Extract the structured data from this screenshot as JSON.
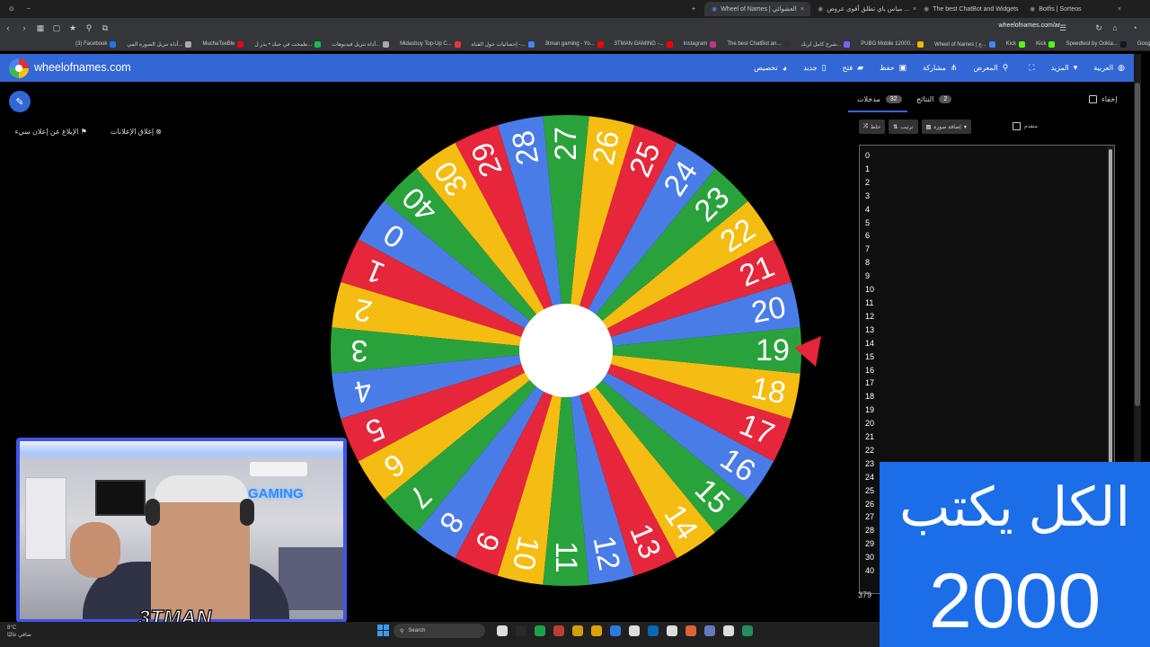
{
  "browser": {
    "tabs": [
      {
        "label": "Wheel of Names | العشوائي",
        "active": true
      },
      {
        "label": "مياس باي تطلق أقوى عروض ...",
        "active": false
      },
      {
        "label": "The best ChatBot and Widgets",
        "active": false
      },
      {
        "label": "Botfis | Sorteos",
        "active": false
      }
    ],
    "new_tab_label": "+",
    "url": "wheelofnames.com/ar",
    "bookmarks": [
      {
        "label": "(3) Facebook",
        "color": "#1877f2"
      },
      {
        "label": "أداة تنزيل الصورة المي...",
        "color": "#aaaaaa"
      },
      {
        "label": "MuchaTseBle",
        "color": "#e60023"
      },
      {
        "label": "طمحت في حبك • يذر ل...",
        "color": "#1db954"
      },
      {
        "label": "أداة تنزيل فيديوهات...",
        "color": "#aaaaaa"
      },
      {
        "label": "Midasbuy Top-Up C...",
        "color": "#e53935"
      },
      {
        "label": "إحصائيات حول القناة -...",
        "color": "#4285f4"
      },
      {
        "label": "3tman gaming - Yo...",
        "color": "#ff0000"
      },
      {
        "label": "3TMAN GAMING -...",
        "color": "#ff0000"
      },
      {
        "label": "Instagram",
        "color": "#c13584"
      },
      {
        "label": "The best ChatBot an...",
        "color": "#333333"
      },
      {
        "label": "شرح كامل لربك...",
        "color": "#7b61ff"
      },
      {
        "label": "PUBG Mobile 12000...",
        "color": "#f4b400"
      },
      {
        "label": "Wheel of Names | ع...",
        "color": "#4285f4"
      },
      {
        "label": "Kick",
        "color": "#53fc18"
      },
      {
        "label": "Kick",
        "color": "#53fc18"
      },
      {
        "label": "Speedtest by Ookla...",
        "color": "#141526"
      },
      {
        "label": "Google",
        "color": "#4285f4"
      }
    ]
  },
  "app": {
    "brand": "wheelofnames.com",
    "menu": [
      {
        "label": "العربية",
        "icon": "globe-icon",
        "glyph": "◍"
      },
      {
        "label": "المزيد",
        "icon": "caret-down-icon",
        "glyph": "▾"
      },
      {
        "label": "",
        "icon": "fullscreen-icon",
        "glyph": "⛶"
      },
      {
        "label": "المعرض",
        "icon": "search-icon",
        "glyph": "⚲"
      },
      {
        "label": "مشاركة",
        "icon": "share-icon",
        "glyph": "⋔"
      },
      {
        "label": "حفظ",
        "icon": "save-icon",
        "glyph": "▣"
      },
      {
        "label": "فتح",
        "icon": "folder-icon",
        "glyph": "▰"
      },
      {
        "label": "جديد",
        "icon": "new-file-icon",
        "glyph": "▯"
      },
      {
        "label": "تخصيص",
        "icon": "palette-icon",
        "glyph": "◕"
      }
    ],
    "ads": {
      "close": "إغلاق الإعلانات",
      "report": "الإبلاغ عن إعلان سيء"
    }
  },
  "wheel": {
    "labels": [
      "0",
      "1",
      "2",
      "3",
      "4",
      "5",
      "6",
      "7",
      "8",
      "9",
      "10",
      "11",
      "12",
      "13",
      "14",
      "15",
      "16",
      "17",
      "18",
      "19",
      "20",
      "21",
      "22",
      "23",
      "24",
      "25",
      "26",
      "27",
      "28",
      "29",
      "30",
      "40"
    ],
    "palette": [
      "#4a7ce8",
      "#e5263b",
      "#f5bd12",
      "#2aa23c"
    ],
    "text_color": "#ffffff"
  },
  "panel": {
    "entries_tab": "مدخلات",
    "entries_count": "32",
    "results_tab": "النتائج",
    "results_count": "2",
    "hide_label": "إخفاء",
    "shuffle": "خلط",
    "sort": "ترتيب",
    "add_image": "إضافة صورة",
    "advanced": "متقدم",
    "entries": [
      "0",
      "1",
      "2",
      "3",
      "4",
      "5",
      "6",
      "7",
      "8",
      "9",
      "10",
      "11",
      "12",
      "13",
      "14",
      "15",
      "16",
      "17",
      "18",
      "19",
      "20",
      "21",
      "22",
      "23",
      "24",
      "25",
      "26",
      "27",
      "28",
      "29",
      "30",
      "40"
    ],
    "footer_count": "379"
  },
  "stream": {
    "cam_tag": "3TMAN",
    "neon": "GAMING",
    "overlay_line1": "الكل يكتب",
    "overlay_line2": "2000"
  },
  "taskbar": {
    "weather_temp": "8°C",
    "weather_desc": "صافي غالبًا",
    "search_placeholder": "Search",
    "app_colors": [
      "#ffffff",
      "#2b2b2b",
      "#1db954",
      "#db4437",
      "#f4b400",
      "#ffb900",
      "#2d8cff",
      "#ffffff",
      "#0078d4",
      "#ffffff",
      "#ff7139",
      "#7289da",
      "#ffffff",
      "#26a269"
    ]
  }
}
